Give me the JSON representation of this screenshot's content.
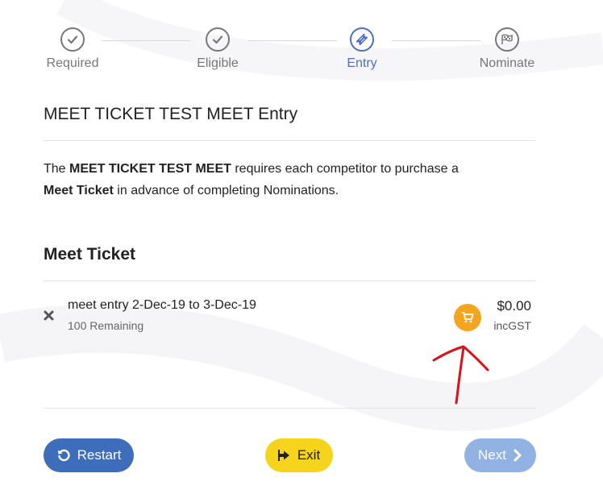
{
  "stepper": {
    "steps": [
      {
        "label": "Required",
        "icon": "check-circle-icon",
        "state": "done"
      },
      {
        "label": "Eligible",
        "icon": "check-circle-icon",
        "state": "done"
      },
      {
        "label": "Entry",
        "icon": "ticket-icon",
        "state": "active"
      },
      {
        "label": "Nominate",
        "icon": "flag-icon",
        "state": "pending"
      }
    ]
  },
  "page": {
    "title": "MEET TICKET TEST MEET Entry"
  },
  "description": {
    "pre": "The ",
    "meet_name": "MEET TICKET TEST MEET",
    "mid": " requires each competitor to purchase a ",
    "ticket_term": "Meet Ticket",
    "post": " in advance of completing Nominations."
  },
  "section": {
    "title": "Meet Ticket"
  },
  "ticket": {
    "name": "meet entry 2-Dec-19 to 3-Dec-19",
    "remaining": "100 Remaining",
    "price": "$0.00",
    "tax_note": "incGST",
    "remove_icon": "close-icon",
    "cart_icon": "cart-icon"
  },
  "actions": {
    "restart_label": "Restart",
    "exit_label": "Exit",
    "next_label": "Next"
  },
  "colors": {
    "accent": "#4b6fc4",
    "restart": "#3e6dbb",
    "exit": "#f7d41c",
    "next": "#91b2e3",
    "cart": "#f4a41e",
    "annotation": "#d9111b"
  }
}
